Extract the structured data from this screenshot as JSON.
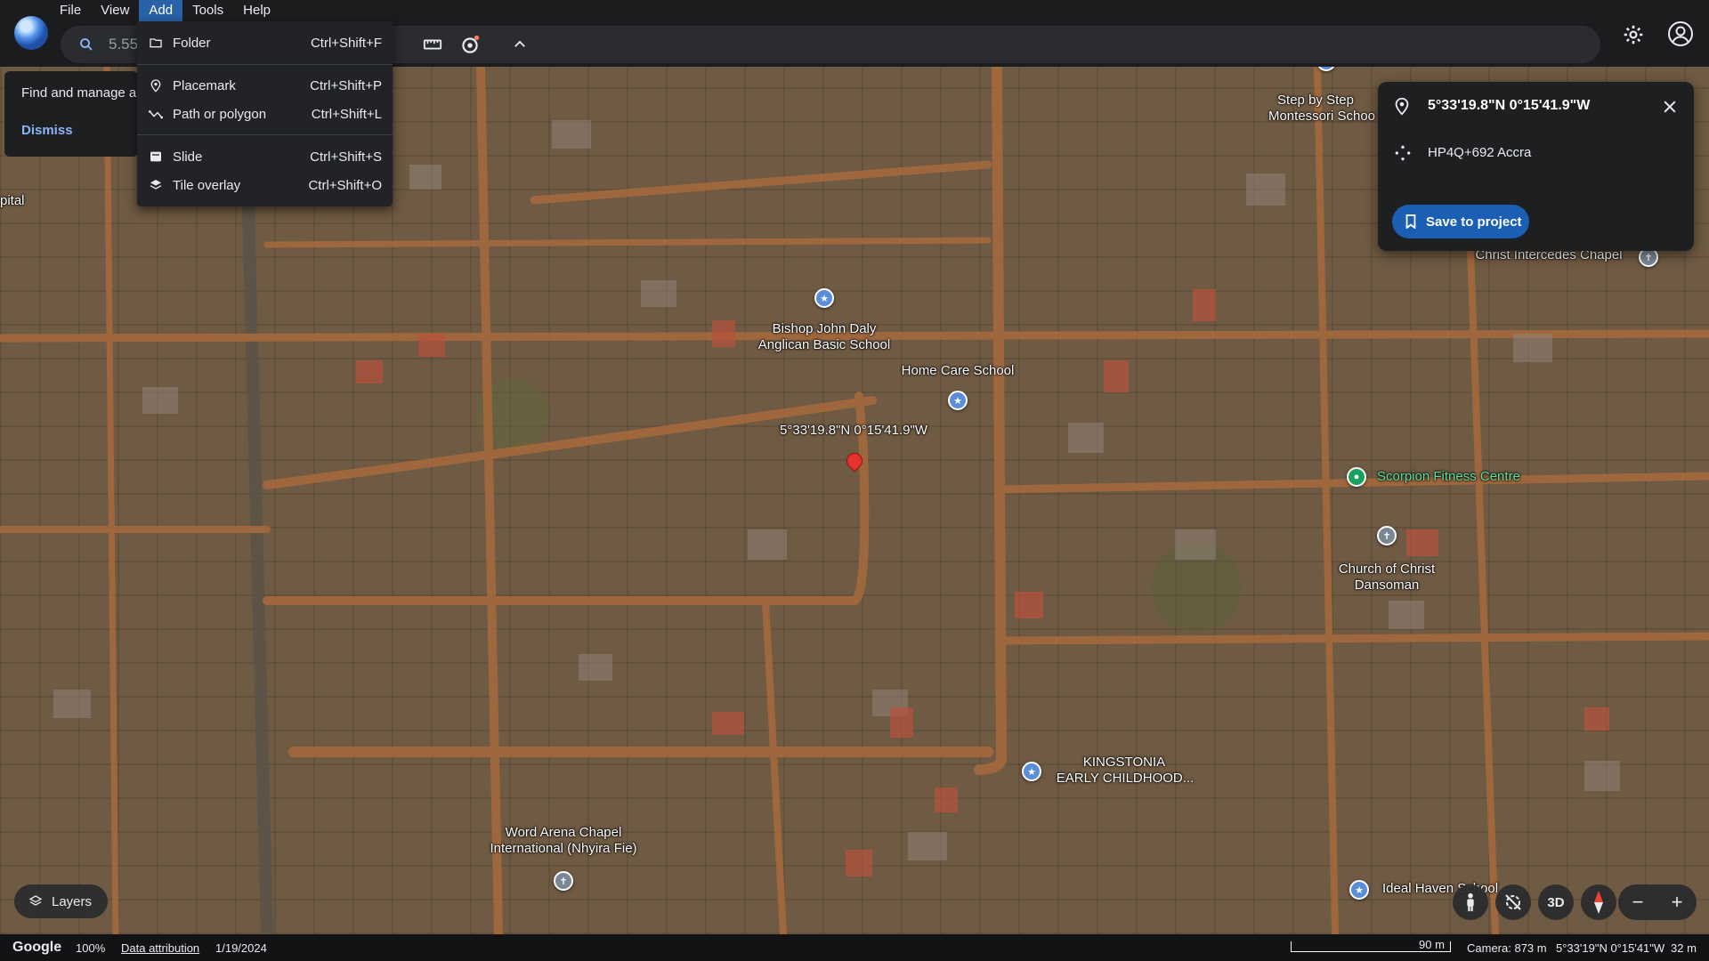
{
  "menu": {
    "items": [
      {
        "label": "File",
        "active": false
      },
      {
        "label": "View",
        "active": false
      },
      {
        "label": "Add",
        "active": true
      },
      {
        "label": "Tools",
        "active": false
      },
      {
        "label": "Help",
        "active": false
      }
    ]
  },
  "search": {
    "value": "5.55",
    "comma": ","
  },
  "add_menu": {
    "items": [
      {
        "icon": "folder-icon",
        "label": "Folder",
        "shortcut": "Ctrl+Shift+F"
      },
      {
        "icon": "placemark-icon",
        "label": "Placemark",
        "shortcut": "Ctrl+Shift+P"
      },
      {
        "icon": "path-icon",
        "label": "Path or polygon",
        "shortcut": "Ctrl+Shift+L"
      },
      {
        "icon": "slide-icon",
        "label": "Slide",
        "shortcut": "Ctrl+Shift+S"
      },
      {
        "icon": "tile-overlay-icon",
        "label": "Tile overlay",
        "shortcut": "Ctrl+Shift+O"
      }
    ]
  },
  "notice": {
    "text": "Find and manage all",
    "dismiss": "Dismiss"
  },
  "card": {
    "title": "5°33'19.8\"N 0°15'41.9\"W",
    "plus_code": "HP4Q+692 Accra",
    "save_label": "Save to project"
  },
  "map": {
    "pin_label": "5°33'19.8\"N 0°15'41.9\"W",
    "places": [
      {
        "name": "Bishop John Daly",
        "name2": "Anglican Basic School",
        "kind": "school"
      },
      {
        "name": "Home Care School",
        "kind": "school"
      },
      {
        "name": "Step by Step",
        "name2": "Montessori Schoo",
        "kind": "school"
      },
      {
        "name": "Christ Intercedes Chapel",
        "kind": "church"
      },
      {
        "name": "Scorpion Fitness Centre",
        "kind": "fitness"
      },
      {
        "name": "Church of Christ",
        "name2": "Dansoman",
        "kind": "church"
      },
      {
        "name": "KINGSTONIA",
        "name2": "EARLY CHILDHOOD...",
        "kind": "school"
      },
      {
        "name": "Word Arena Chapel",
        "name2": "International (Nhyira Fie)",
        "kind": "church"
      },
      {
        "name": "Ideal Haven School",
        "kind": "school"
      },
      {
        "name": "pital",
        "kind": "other"
      }
    ]
  },
  "controls": {
    "layers_label": "Layers",
    "three_d_label": "3D",
    "zoom_out": "−",
    "zoom_in": "+"
  },
  "status": {
    "brand": "Google",
    "zoom": "100%",
    "attribution": "Data attribution",
    "date": "1/19/2024",
    "scale": "90 m",
    "camera": "Camera: 873 m",
    "coords": "5°33'19\"N 0°15'41\"W",
    "elevation": "32 m"
  }
}
